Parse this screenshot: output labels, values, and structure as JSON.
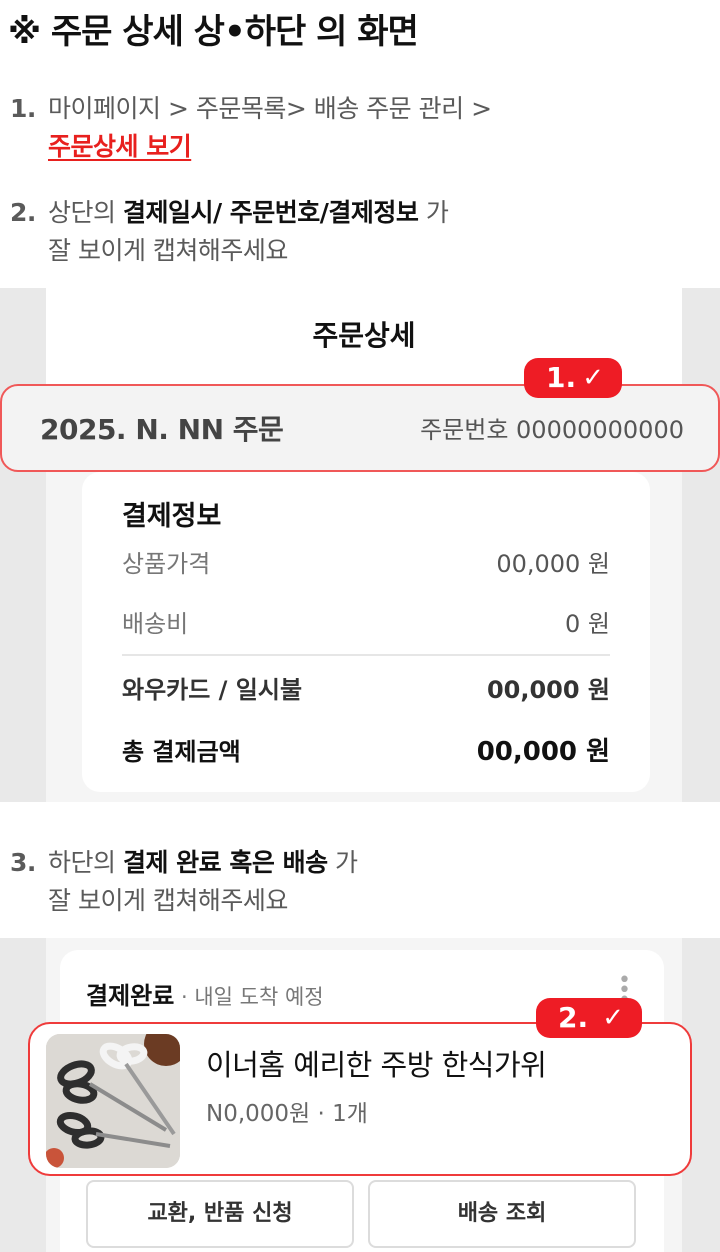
{
  "title": "※ 주문 상세  상•하단 의 화면",
  "steps": {
    "s1": {
      "num": "1.",
      "line1": "마이페이지 > 주문목록> 배송 주문 관리 >",
      "link": "주문상세 보기"
    },
    "s2": {
      "num": "2.",
      "pre": "상단의 ",
      "bold": "결제일시/ 주문번호/결제정보",
      "post": " 가",
      "line2": "잘 보이게 캡쳐해주세요"
    },
    "s3": {
      "num": "3.",
      "pre": "하단의 ",
      "bold": "결제 완료 혹은 배송",
      "post": " 가",
      "line2": "잘 보이게 캡쳐해주세요"
    }
  },
  "top_screen": {
    "header": "주문상세",
    "order_date": "2025. N. NN 주문",
    "order_number": "주문번호 00000000000",
    "badge": {
      "label": "1.",
      "check": "✓"
    },
    "payment": {
      "title": "결제정보",
      "rows": [
        {
          "label": "상품가격",
          "value": "00,000 원"
        },
        {
          "label": "배송비",
          "value": "0 원"
        },
        {
          "label": "와우카드 / 일시불",
          "value": "00,000 원"
        },
        {
          "label": "총 결제금액",
          "value": "00,000 원"
        }
      ]
    }
  },
  "bottom_screen": {
    "status": "결제완료",
    "status_sub": " · 내일 도착 예정",
    "badge": {
      "label": "2.",
      "check": "✓"
    },
    "product": {
      "name": "이너홈 예리한 주방 한식가위",
      "price": "N0,000원 · 1개",
      "image": "kitchen-scissors-photo"
    },
    "buttons": {
      "exchange": "교환, 반품 신청",
      "tracking": "배송 조회"
    }
  },
  "colors": {
    "accent_red": "#ee1c25",
    "outline_red": "#f05858",
    "panel_gray": "#e9e9e9"
  }
}
